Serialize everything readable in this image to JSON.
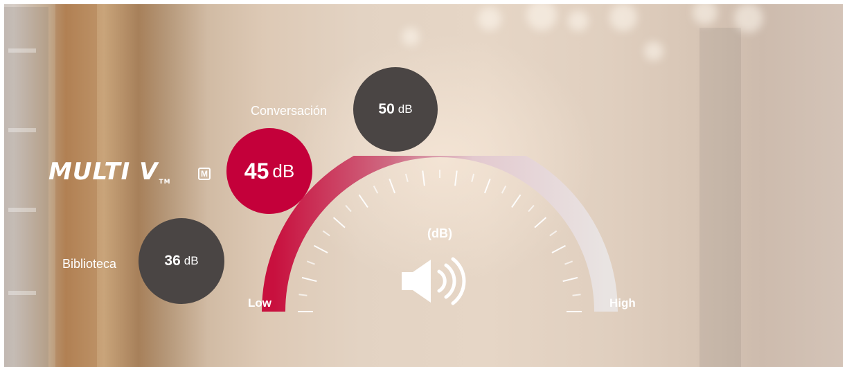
{
  "logo": {
    "text": "MULTI V",
    "tm": "TM",
    "badge": "M"
  },
  "levels": {
    "conversation": {
      "label": "Conversación",
      "value": "50",
      "unit": "dB"
    },
    "multi_v": {
      "value": "45",
      "unit": "dB"
    },
    "library": {
      "label": "Biblioteca",
      "value": "36",
      "unit": "dB"
    }
  },
  "gauge": {
    "unit_label": "(dB)",
    "low_label": "Low",
    "high_label": "High",
    "fill_fraction": 0.35,
    "colors": {
      "fill": "#c8103e",
      "track": "#e8e0dc"
    }
  },
  "colors": {
    "accent": "#c4003a",
    "bubble_dark": "#4a4544"
  },
  "icons": {
    "speaker": "speaker-volume-icon"
  }
}
